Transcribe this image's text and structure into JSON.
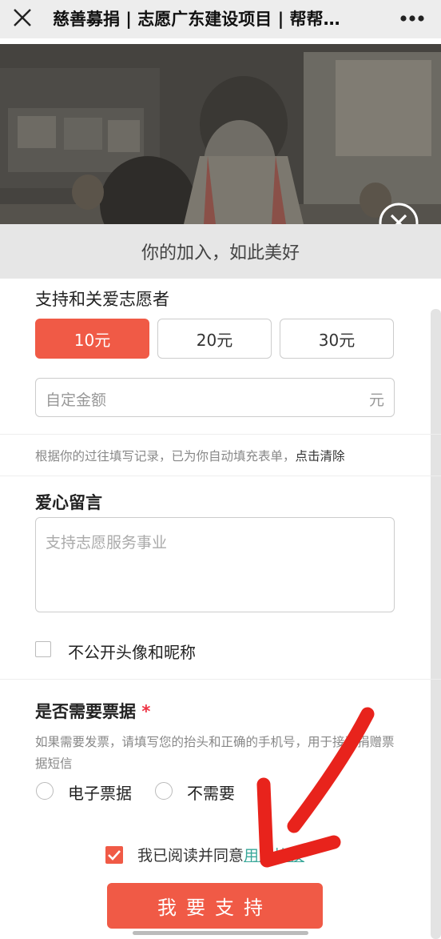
{
  "topbar": {
    "title": "慈善募捐 | 志愿广东建设项目 | 帮帮…"
  },
  "hero": {
    "slogan": "你的加入，如此美好"
  },
  "amount": {
    "heading": "支持和关爱志愿者",
    "options": [
      {
        "label": "10元",
        "selected": true
      },
      {
        "label": "20元",
        "selected": false
      },
      {
        "label": "30元",
        "selected": false
      }
    ],
    "custom_placeholder": "自定金额",
    "custom_unit": "元"
  },
  "autofill": {
    "hint": "根据你的过往填写记录，已为你自动填充表单，",
    "clear_link": "点击清除"
  },
  "message": {
    "heading": "爱心留言",
    "placeholder": "支持志愿服务事业"
  },
  "anonymous": {
    "label": "不公开头像和昵称",
    "checked": false
  },
  "receipt": {
    "heading": "是否需要票据",
    "required_mark": "*",
    "description": "如果需要发票，请填写您的抬头和正确的手机号，用于接受捐赠票据短信",
    "options": [
      {
        "label": "电子票据"
      },
      {
        "label": "不需要"
      }
    ]
  },
  "agreement": {
    "text": "我已阅读并同意",
    "link": "用户协议",
    "checked": true
  },
  "submit": {
    "label": "我要支持"
  },
  "colors": {
    "accent": "#f05a46",
    "link": "#3aa89a"
  }
}
